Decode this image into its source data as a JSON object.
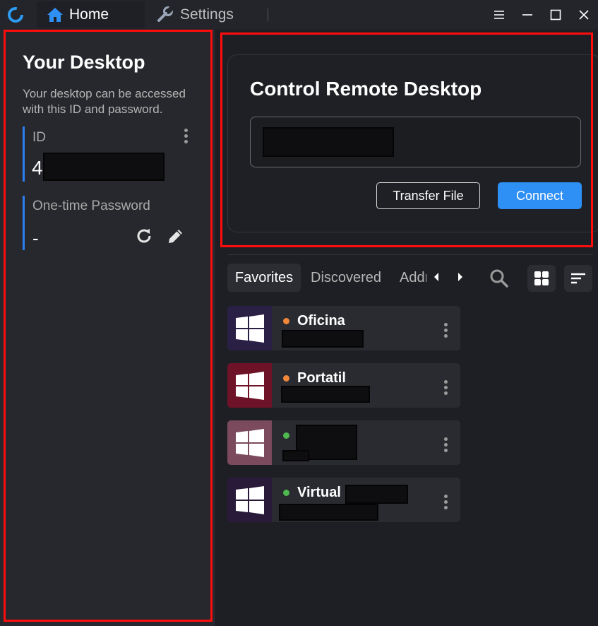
{
  "window": {
    "tabs": [
      {
        "label": "Home",
        "icon": "home-icon"
      },
      {
        "label": "Settings",
        "icon": "wrench-icon"
      }
    ],
    "controls": [
      "menu-icon",
      "minimize-icon",
      "maximize-icon",
      "close-icon"
    ]
  },
  "your_desktop": {
    "title": "Your Desktop",
    "description": "Your desktop can be accessed with this ID and password.",
    "id_label": "ID",
    "id_value": "4",
    "password_label": "One-time Password",
    "password_value": "-"
  },
  "control": {
    "title": "Control Remote Desktop",
    "transfer_label": "Transfer File",
    "connect_label": "Connect"
  },
  "peers": {
    "tabs": [
      "Favorites",
      "Discovered",
      "Address Book"
    ],
    "active_tab": "Favorites",
    "items": [
      {
        "name": "Oficina",
        "status": "offline",
        "status_color": "#f0873a",
        "thumb_color": "#2a1f45"
      },
      {
        "name": "Portatil",
        "status": "offline",
        "status_color": "#f0873a",
        "thumb_color": "#6e1327"
      },
      {
        "name": "",
        "status": "online",
        "status_color": "#4fb84f",
        "thumb_color": "#7b4a5c"
      },
      {
        "name": "Virtual",
        "status": "online",
        "status_color": "#4fb84f",
        "thumb_color": "#2a1a3a"
      }
    ]
  },
  "colors": {
    "accent": "#2e8ff5",
    "highlight_box": "#ff0d0d"
  }
}
